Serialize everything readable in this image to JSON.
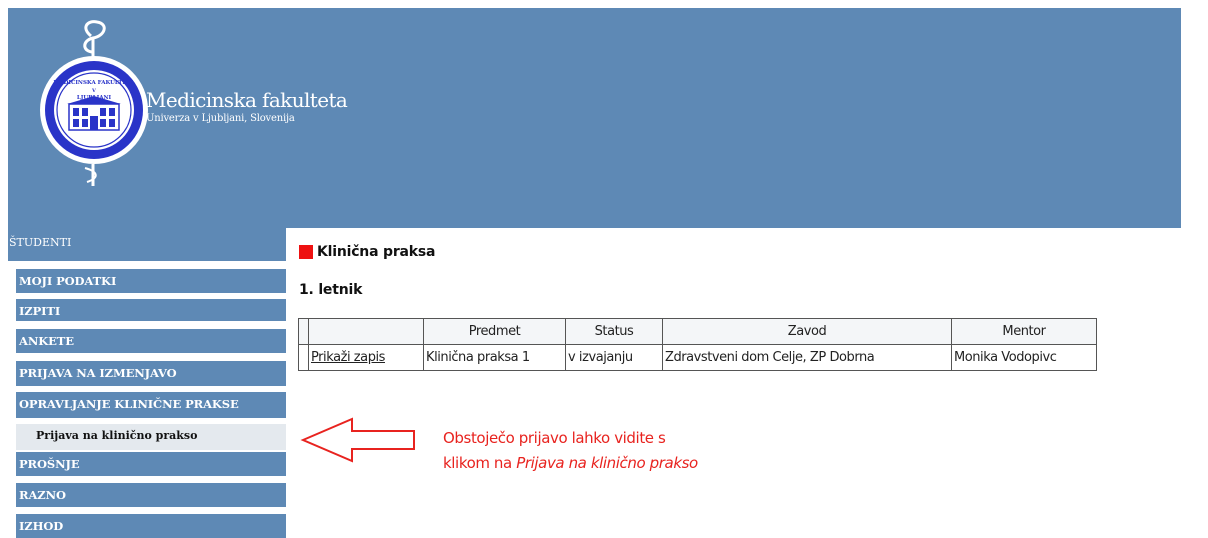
{
  "header": {
    "brand_name": "Medicinska fakulteta",
    "brand_subtitle": "Univerza v Ljubljani, Slovenija",
    "seal_text": [
      "MEDICINSKA FAKULTETA",
      "V",
      "LJUBLJANI"
    ],
    "background_color": "#5e89b5"
  },
  "sidebar": {
    "section_title": "ŠTUDENTI",
    "items": [
      {
        "label": "MOJI PODATKI"
      },
      {
        "label": "IZPITI"
      },
      {
        "label": "ANKETE"
      },
      {
        "label": "PRIJAVA NA IZMENJAVO"
      },
      {
        "label": "OPRAVLJANJE KLINIČNE PRAKSE"
      },
      {
        "label": "Prijava na klinično prakso",
        "sub": true
      },
      {
        "label": "PROŠNJE"
      },
      {
        "label": "RAZNO"
      },
      {
        "label": "IZHOD"
      }
    ]
  },
  "main": {
    "title": "Klinična praksa",
    "year_heading": "1. letnik",
    "table": {
      "columns": [
        "",
        "",
        "Predmet",
        "Status",
        "Zavod",
        "Mentor"
      ],
      "rows": [
        {
          "action": "Prikaži zapis",
          "subject": "Klinična praksa 1",
          "status": "v izvajanju",
          "institution": "Zdravstveni dom Celje, ZP Dobrna",
          "mentor": "Monika Vodopivc"
        }
      ]
    }
  },
  "annotation": {
    "line1": "Obstoječo prijavo lahko vidite s",
    "line2_prefix": "klikom na ",
    "line2_emphasis": "Prijava na klinično prakso",
    "color": "#e8231f"
  },
  "colors": {
    "accent_square": "#ee1111",
    "sub_item_background": "#e4e9ee"
  }
}
